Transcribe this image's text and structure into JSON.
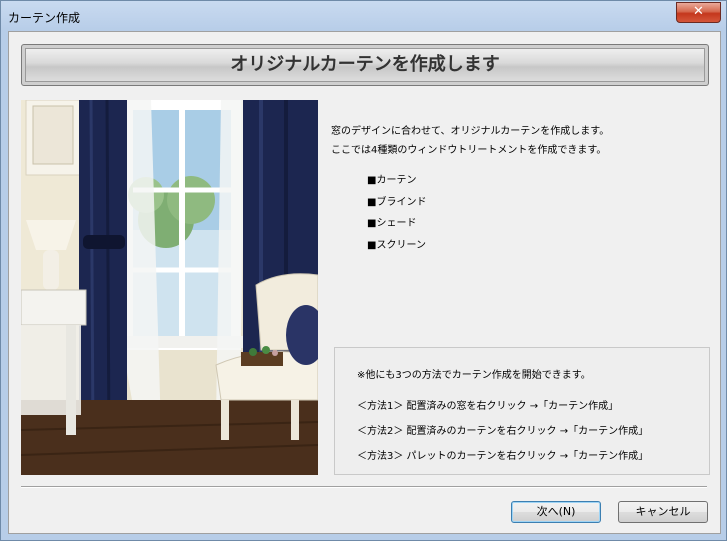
{
  "window": {
    "title": "カーテン作成",
    "close_glyph": "✕"
  },
  "banner": {
    "text": "オリジナルカーテンを作成します"
  },
  "description": [
    "窓のデザインに合わせて、オリジナルカーテンを作成します。",
    "ここでは4種類のウィンドウトリートメントを作成できます。"
  ],
  "types": [
    "■カーテン",
    "■ブラインド",
    "■シェード",
    "■スクリーン"
  ],
  "note": {
    "heading": "※他にも3つの方法でカーテン作成を開始できます。",
    "methods": [
      "＜方法1＞ 配置済みの窓を右クリック →「カーテン作成」",
      "＜方法2＞ 配置済みのカーテンを右クリック →「カーテン作成」",
      "＜方法3＞ パレットのカーテンを右クリック →「カーテン作成」"
    ]
  },
  "buttons": {
    "next": "次へ(N)",
    "cancel": "キャンセル"
  },
  "colors": {
    "curtain": "#1c2650",
    "floor": "#4a2f1c",
    "wall": "#e9e3cf",
    "titlebar": "#b7cde8",
    "close": "#c4371d"
  },
  "icons": {
    "close": "close-icon"
  }
}
